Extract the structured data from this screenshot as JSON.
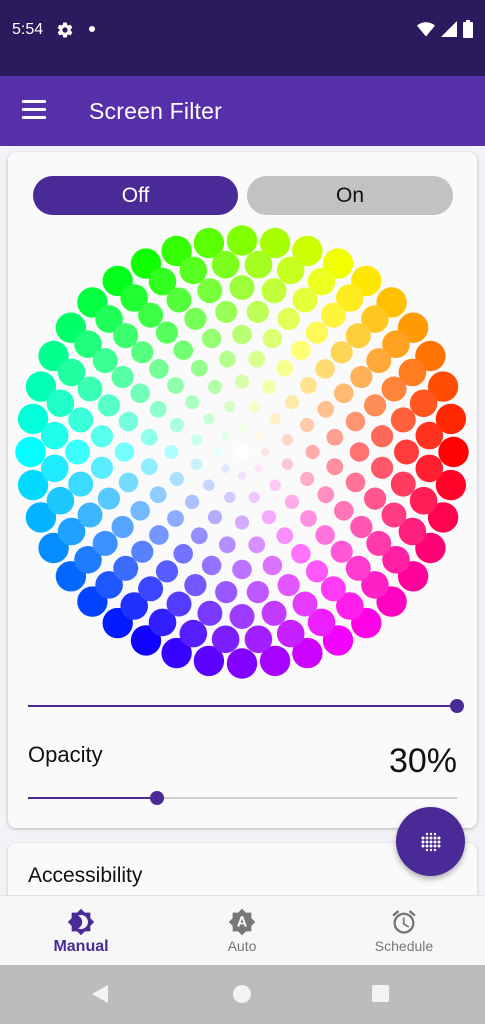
{
  "status_bar": {
    "time": "5:54",
    "icons": [
      "gear-icon",
      "notification-dot-icon",
      "wifi-icon",
      "signal-icon",
      "battery-icon"
    ]
  },
  "app_bar": {
    "title": "Screen Filter",
    "menu_icon": "menu-icon"
  },
  "toggle": {
    "off_label": "Off",
    "on_label": "On",
    "selected": "Off"
  },
  "color_wheel": {
    "rings": 9,
    "selected_color": "#ffffff"
  },
  "color_slider": {
    "value_fraction": 1.0
  },
  "opacity": {
    "label": "Opacity",
    "value_text": "30%",
    "value_fraction": 0.3
  },
  "fab": {
    "icon": "filter-dots-icon"
  },
  "accessibility": {
    "title": "Accessibility"
  },
  "bottom_nav": {
    "items": [
      {
        "label": "Manual",
        "icon": "brightness-icon",
        "active": true
      },
      {
        "label": "Auto",
        "icon": "auto-brightness-icon",
        "active": false
      },
      {
        "label": "Schedule",
        "icon": "alarm-clock-icon",
        "active": false
      }
    ]
  },
  "system_nav": {
    "icons": [
      "back-icon",
      "home-icon",
      "recents-icon"
    ]
  },
  "colors": {
    "status_bar_bg": "#2b1a5e",
    "app_bar_bg": "#5630a8",
    "accent": "#4a2a96",
    "toggle_inactive": "#c2c2c2"
  }
}
